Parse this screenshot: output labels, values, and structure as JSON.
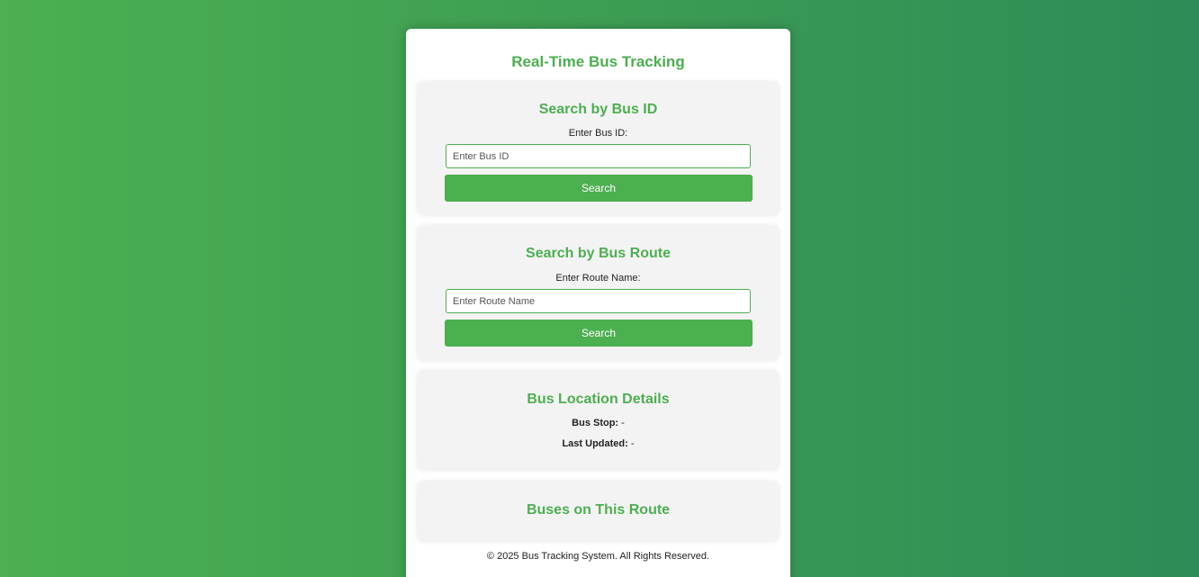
{
  "app": {
    "title": "Real-Time Bus Tracking"
  },
  "search_bus_id": {
    "heading": "Search by Bus ID",
    "label": "Enter Bus ID:",
    "placeholder": "Enter Bus ID",
    "value": "",
    "button_label": "Search"
  },
  "search_route": {
    "heading": "Search by Bus Route",
    "label": "Enter Route Name:",
    "placeholder": "Enter Route Name",
    "value": "",
    "button_label": "Search"
  },
  "location_details": {
    "heading": "Bus Location Details",
    "bus_stop_label": "Bus Stop:",
    "bus_stop_value": "-",
    "last_updated_label": "Last Updated:",
    "last_updated_value": "-"
  },
  "route_buses": {
    "heading": "Buses on This Route"
  },
  "footer": {
    "text": "© 2025 Bus Tracking System. All Rights Reserved."
  },
  "colors": {
    "accent": "#4caf50",
    "background_start": "#4caf50",
    "background_end": "#2e8b57",
    "card": "#f3f3f3"
  }
}
